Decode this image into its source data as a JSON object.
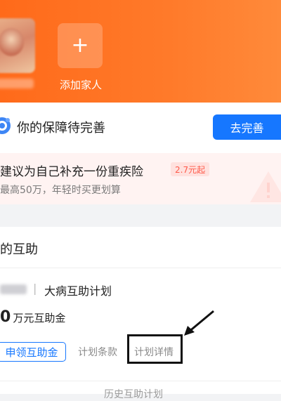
{
  "header": {
    "add_family_label": "添加家人",
    "add_icon": "plus-icon"
  },
  "protection": {
    "title": "你的保障待完善",
    "cta_label": "去完善",
    "suggest_title": "建议为自己补充一份重疾险",
    "price_badge": "2.7元起",
    "suggest_subtitle": "最高50万，年轻时买更划算"
  },
  "mutual_aid": {
    "section_title": "的互助",
    "separator": "|",
    "plan_name": "大病互助计划",
    "amount_value": "0",
    "amount_unit": "万元互助金",
    "claim_button": "申领互助金",
    "plan_terms": "计划条款",
    "plan_details": "计划详情",
    "history_link": "历史互助计划"
  },
  "colors": {
    "header_orange": "#ff6a1a",
    "primary_blue": "#1677ff",
    "badge_red": "#ff5a4a"
  }
}
